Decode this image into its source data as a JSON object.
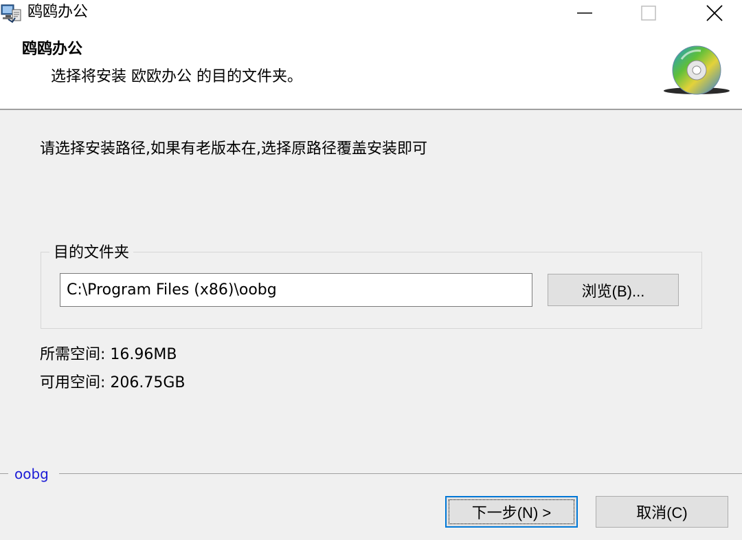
{
  "window": {
    "title": "鸥鸥办公",
    "icons": {
      "app": "installer-icon",
      "minimize": "minimize-icon",
      "maximize": "maximize-icon",
      "close": "close-icon"
    }
  },
  "header": {
    "title": "鸥鸥办公",
    "subtitle": "选择将安装 欧欧办公 的目的文件夹。",
    "icon": "cd-disc-icon"
  },
  "main": {
    "intro": "请选择安装路径,如果有老版本在,选择原路径覆盖安装即可",
    "group_label": "目的文件夹",
    "path_value": "C:\\Program Files (x86)\\oobg",
    "browse_label": "浏览(B)...",
    "space_required": "所需空间: 16.96MB",
    "space_available": "可用空间: 206.75GB"
  },
  "footer": {
    "brand": "oobg",
    "brand_color": "#1c1cd6",
    "next_label": "下一步(N) >",
    "cancel_label": "取消(C)",
    "focus_color": "#0078d7"
  }
}
